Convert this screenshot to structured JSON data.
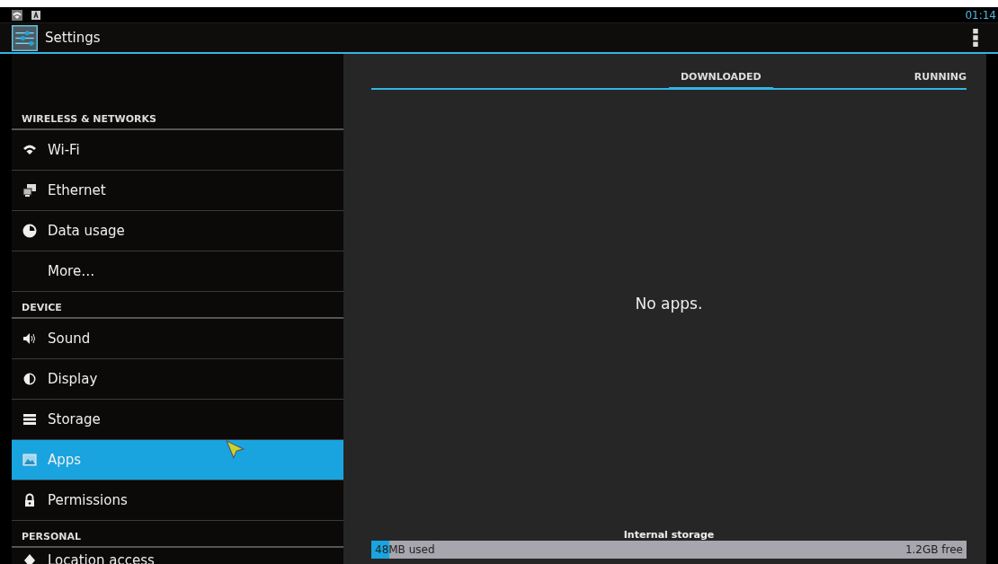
{
  "status_bar": {
    "time": "01:14"
  },
  "action_bar": {
    "title": "Settings"
  },
  "sidebar": {
    "items": [
      {
        "kind": "header",
        "label": "WIRELESS & NETWORKS"
      },
      {
        "kind": "item",
        "label": "Wi-Fi",
        "selected": false
      },
      {
        "kind": "item",
        "label": "Ethernet",
        "selected": false
      },
      {
        "kind": "item",
        "label": "Data usage",
        "selected": false
      },
      {
        "kind": "item",
        "label": "More…",
        "selected": false
      },
      {
        "kind": "header",
        "label": "DEVICE"
      },
      {
        "kind": "item",
        "label": "Sound",
        "selected": false
      },
      {
        "kind": "item",
        "label": "Display",
        "selected": false
      },
      {
        "kind": "item",
        "label": "Storage",
        "selected": false
      },
      {
        "kind": "item",
        "label": "Apps",
        "selected": true
      },
      {
        "kind": "item",
        "label": "Permissions",
        "selected": false
      },
      {
        "kind": "header",
        "label": "PERSONAL"
      },
      {
        "kind": "item",
        "label": "Location access",
        "selected": false
      }
    ]
  },
  "tabs": [
    {
      "label": "DOWNLOADED",
      "selected": true
    },
    {
      "label": "RUNNING",
      "selected": false
    }
  ],
  "empty_message": "No apps.",
  "storage": {
    "title": "Internal storage",
    "used": "48MB used",
    "free": "1.2GB free",
    "level": 0.03
  }
}
